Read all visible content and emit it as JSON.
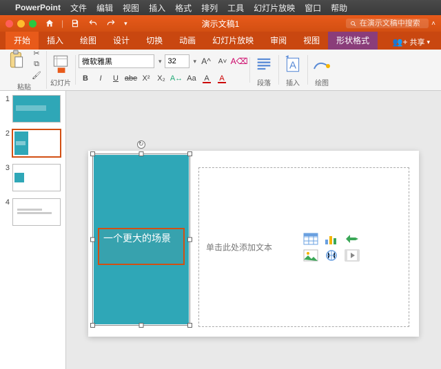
{
  "mac_menu": {
    "app": "PowerPoint",
    "items": [
      "文件",
      "编辑",
      "视图",
      "插入",
      "格式",
      "排列",
      "工具",
      "幻灯片放映",
      "窗口",
      "帮助"
    ]
  },
  "titlebar": {
    "doc_title": "演示文稿1",
    "search_placeholder": "在演示文稿中搜索"
  },
  "ribbon_tabs": {
    "items": [
      "开始",
      "插入",
      "绘图",
      "设计",
      "切换",
      "动画",
      "幻灯片放映",
      "审阅",
      "视图",
      "形状格式"
    ],
    "active_index": 0,
    "contextual_index": 9,
    "share_label": "共享"
  },
  "ribbon": {
    "clipboard_label": "粘贴",
    "slides_label": "幻灯片",
    "font_name": "微软雅黑",
    "font_size": "32",
    "paragraph_label": "段落",
    "insert_label": "插入",
    "draw_label": "绘图"
  },
  "thumbnails": [
    {
      "n": "1"
    },
    {
      "n": "2"
    },
    {
      "n": "3"
    },
    {
      "n": "4"
    }
  ],
  "selected_thumb_index": 1,
  "slide": {
    "title_text": "一个更大的场景",
    "content_placeholder": "单击此处添加文本"
  }
}
